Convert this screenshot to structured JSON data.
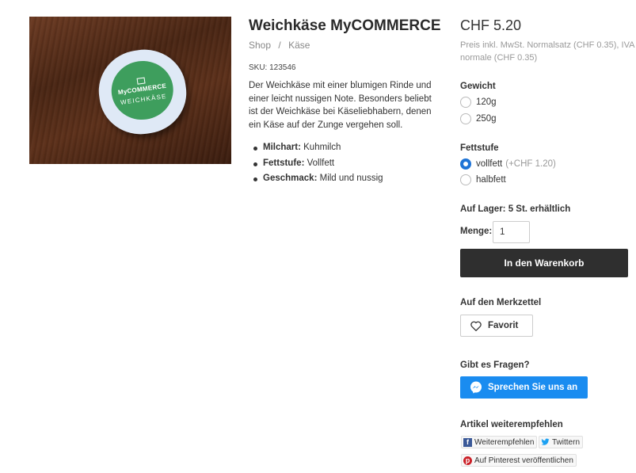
{
  "product": {
    "title": "Weichkäse MyCOMMERCE",
    "image_brand": "MyCOMMERCE",
    "image_name": "WEICHKÄSE",
    "breadcrumb": [
      "Shop",
      "/",
      "Käse"
    ],
    "sku": "SKU: 123546",
    "description": "Der Weichkäse mit einer blumigen Rinde und einer leicht nussigen Note. Besonders beliebt ist der Weichkäse bei Käseliebhabern, denen ein Käse auf der Zunge vergehen soll.",
    "features": [
      {
        "label": "Milchart",
        "value": " Kuhmilch"
      },
      {
        "label": "Fettstufe",
        "value": " Vollfett"
      },
      {
        "label": "Geschmack",
        "value": " Mild und nussig"
      }
    ]
  },
  "buybox": {
    "price": "CHF 5.20",
    "price_note": "Preis inkl. MwSt. Normalsatz (CHF 0.35), IVA normale (CHF 0.35)",
    "weight": {
      "label": "Gewicht",
      "options": [
        {
          "label": "120g",
          "checked": false
        },
        {
          "label": "250g",
          "checked": false
        }
      ]
    },
    "fat": {
      "label": "Fettstufe",
      "options": [
        {
          "label": "vollfett",
          "surcharge": "(+CHF 1.20)",
          "checked": true
        },
        {
          "label": "halbfett",
          "checked": false
        }
      ]
    },
    "stock": "Auf Lager: 5 St. erhältlich",
    "qty_label": "Menge:",
    "qty_value": "1",
    "cart_label": "In den Warenkorb",
    "wishlist_label": "Auf den Merkzettel",
    "favorite_label": "Favorit",
    "questions_label": "Gibt es Fragen?",
    "messenger_label": "Sprechen Sie uns an",
    "share_label": "Artikel weiterempfehlen",
    "share": {
      "facebook": "Weiterempfehlen",
      "twitter": "Twittern",
      "pinterest": "Auf Pinterest veröffentlichen"
    }
  },
  "colors": {
    "accent": "#1f74d6",
    "messenger": "#1a8cf0",
    "cart": "#2f2f2f",
    "cheese_label": "#3e9e5d",
    "facebook": "#3b5998",
    "twitter": "#1da1f2",
    "pinterest": "#cb2027"
  }
}
